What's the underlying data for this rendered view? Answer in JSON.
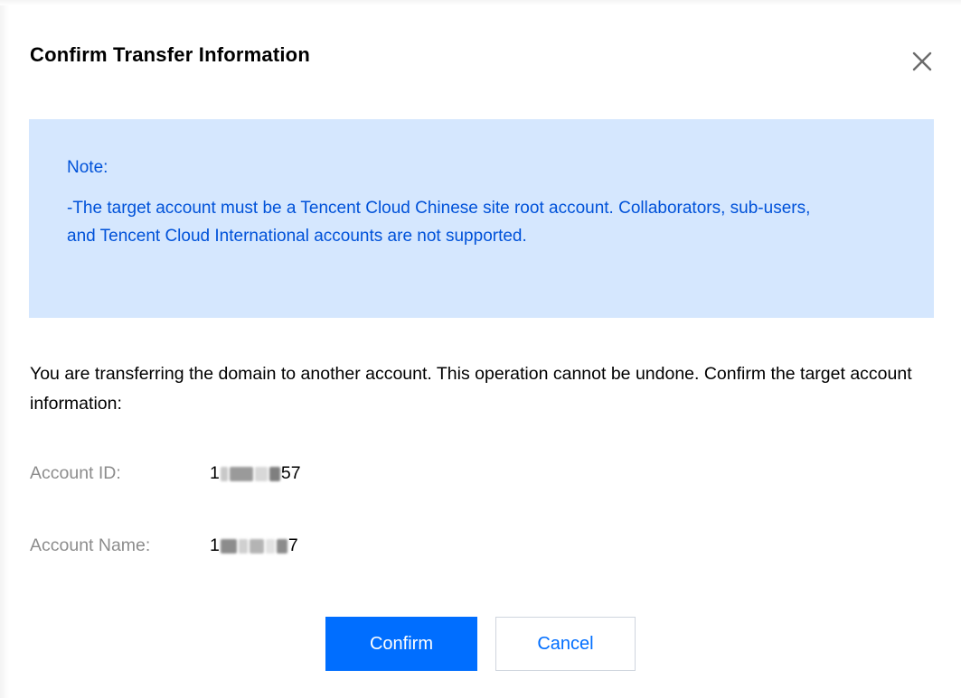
{
  "dialog": {
    "title": "Confirm Transfer Information",
    "close_icon": "close-icon"
  },
  "note": {
    "title": "Note:",
    "body": "-The target account must be a Tencent Cloud Chinese site root account. Collaborators, sub-users, and Tencent Cloud International accounts are not supported."
  },
  "description": "You are transferring the domain to another account. This operation cannot be undone. Confirm the target account information:",
  "fields": {
    "account_id": {
      "label": "Account ID:",
      "value_prefix": "1",
      "value_suffix": "57"
    },
    "account_name": {
      "label": "Account Name:",
      "value_prefix": "1",
      "value_suffix": "7"
    }
  },
  "buttons": {
    "confirm_label": "Confirm",
    "cancel_label": "Cancel"
  },
  "colors": {
    "primary": "#006eff",
    "note_background": "#d5e7fe",
    "note_text": "#0052d9",
    "label_gray": "#8c8c8c"
  }
}
